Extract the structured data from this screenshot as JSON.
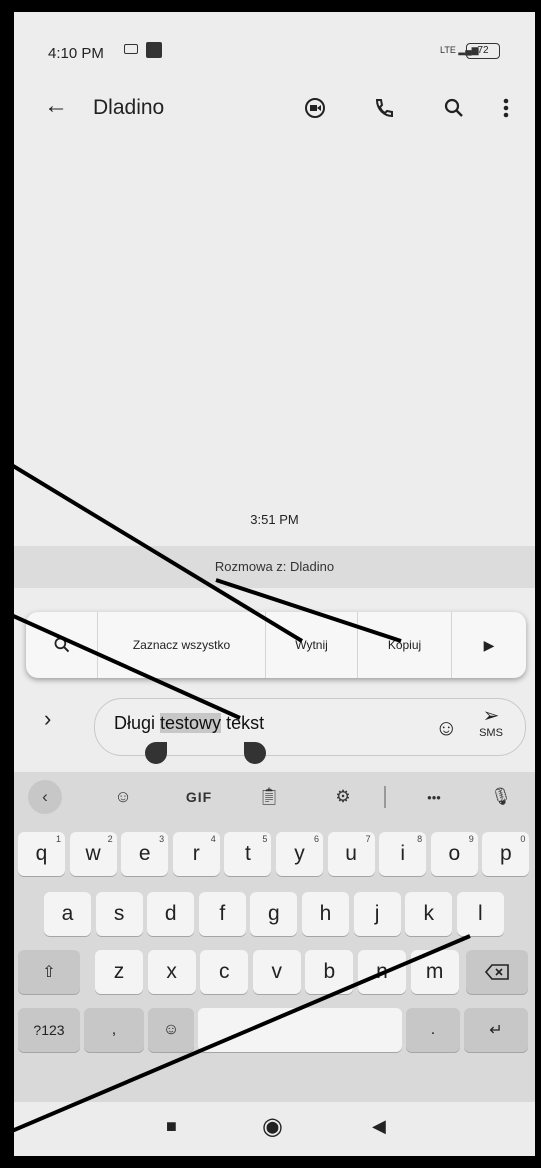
{
  "status": {
    "time": "4:10 PM",
    "signal": "LTE",
    "battery": "72"
  },
  "appbar": {
    "back_icon": "arrow-left-icon",
    "title": "Dladino"
  },
  "conversation": {
    "timestamp": "3:51 PM",
    "banner": "Rozmowa z: Dladino"
  },
  "selection_toolbar": {
    "select_all": "Zaznacz wszystko",
    "cut": "Wytnij",
    "copy": "Kopiuj"
  },
  "compose": {
    "text_before": "Długi ",
    "text_selected": "testowy",
    "text_after": " tekst",
    "send_label": "SMS"
  },
  "keyboard": {
    "suggestions": {
      "gif": "GIF",
      "more": "•••"
    },
    "row1": [
      {
        "k": "q",
        "n": "1"
      },
      {
        "k": "w",
        "n": "2"
      },
      {
        "k": "e",
        "n": "3"
      },
      {
        "k": "r",
        "n": "4"
      },
      {
        "k": "t",
        "n": "5"
      },
      {
        "k": "y",
        "n": "6"
      },
      {
        "k": "u",
        "n": "7"
      },
      {
        "k": "i",
        "n": "8"
      },
      {
        "k": "o",
        "n": "9"
      },
      {
        "k": "p",
        "n": "0"
      }
    ],
    "row2": [
      "a",
      "s",
      "d",
      "f",
      "g",
      "h",
      "j",
      "k",
      "l"
    ],
    "row3": [
      "z",
      "x",
      "c",
      "v",
      "b",
      "n",
      "m"
    ],
    "row4": {
      "symbols": "?123",
      "comma": ",",
      "period": "."
    }
  },
  "colors": {
    "screen_bg": "#ededed",
    "keyboard_bg": "#d9d9d9",
    "key_bg": "#f4f4f4",
    "selection": "#c7c7c7"
  }
}
